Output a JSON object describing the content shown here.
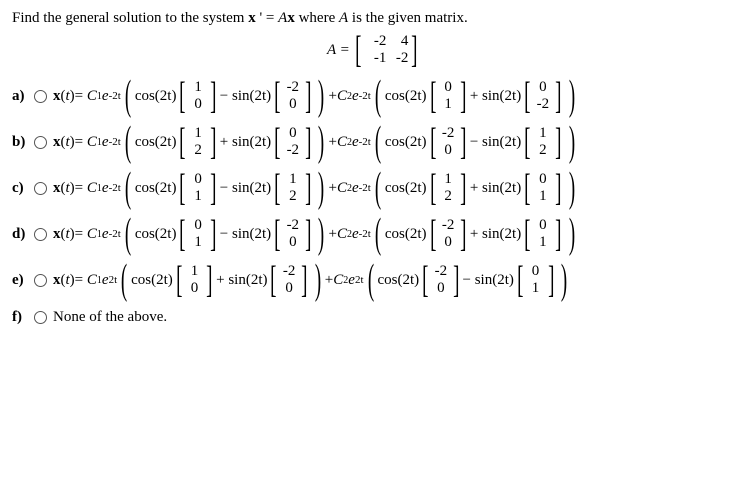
{
  "prompt_pre": "Find the general solution to the system ",
  "prompt_eq": "x ' = Ax",
  "prompt_post": " where ",
  "prompt_A": "A",
  "prompt_end": " is the given matrix.",
  "A_label": "A =",
  "A": [
    [
      "-2",
      "4"
    ],
    [
      "-1",
      "-2"
    ]
  ],
  "options": [
    {
      "id": "a",
      "letter": "a)",
      "coef": "-2t",
      "g1": {
        "cos": "cos(2t)",
        "v1": [
          "1",
          "0"
        ],
        "op": "−",
        "sin": "sin(2t)",
        "v2": [
          "-2",
          "0"
        ]
      },
      "g2": {
        "cos": "cos(2t)",
        "v1": [
          "0",
          "1"
        ],
        "op": "+",
        "sin": "sin(2t)",
        "v2": [
          "0",
          "-2"
        ]
      }
    },
    {
      "id": "b",
      "letter": "b)",
      "coef": "-2t",
      "g1": {
        "cos": "cos(2t)",
        "v1": [
          "1",
          "2"
        ],
        "op": "+",
        "sin": "sin(2t)",
        "v2": [
          "0",
          "-2"
        ]
      },
      "g2": {
        "cos": "cos(2t)",
        "v1": [
          "-2",
          "0"
        ],
        "op": "−",
        "sin": "sin(2t)",
        "v2": [
          "1",
          "2"
        ]
      }
    },
    {
      "id": "c",
      "letter": "c)",
      "coef": "-2t",
      "g1": {
        "cos": "cos(2t)",
        "v1": [
          "0",
          "1"
        ],
        "op": "−",
        "sin": "sin(2t)",
        "v2": [
          "1",
          "2"
        ]
      },
      "g2": {
        "cos": "cos(2t)",
        "v1": [
          "1",
          "2"
        ],
        "op": "+",
        "sin": "sin(2t)",
        "v2": [
          "0",
          "1"
        ]
      }
    },
    {
      "id": "d",
      "letter": "d)",
      "coef": "-2t",
      "g1": {
        "cos": "cos(2t)",
        "v1": [
          "0",
          "1"
        ],
        "op": "−",
        "sin": "sin(2t)",
        "v2": [
          "-2",
          "0"
        ]
      },
      "g2": {
        "cos": "cos(2t)",
        "v1": [
          "-2",
          "0"
        ],
        "op": "+",
        "sin": "sin(2t)",
        "v2": [
          "0",
          "1"
        ]
      }
    },
    {
      "id": "e",
      "letter": "e)",
      "coef": "2t",
      "g1": {
        "cos": "cos(2t)",
        "v1": [
          "1",
          "0"
        ],
        "op": "+",
        "sin": "sin(2t)",
        "v2": [
          "-2",
          "0"
        ]
      },
      "g2": {
        "cos": "cos(2t)",
        "v1": [
          "-2",
          "0"
        ],
        "op": "−",
        "sin": "sin(2t)",
        "v2": [
          "0",
          "1"
        ]
      }
    }
  ],
  "optF": {
    "letter": "f)",
    "text": "None of the above."
  },
  "tokens": {
    "xeq": "x(t)= ",
    "C1": "C",
    "sub1": "1",
    "C2": "C",
    "sub2": "2",
    "e": "e",
    "plusC2": " + "
  }
}
